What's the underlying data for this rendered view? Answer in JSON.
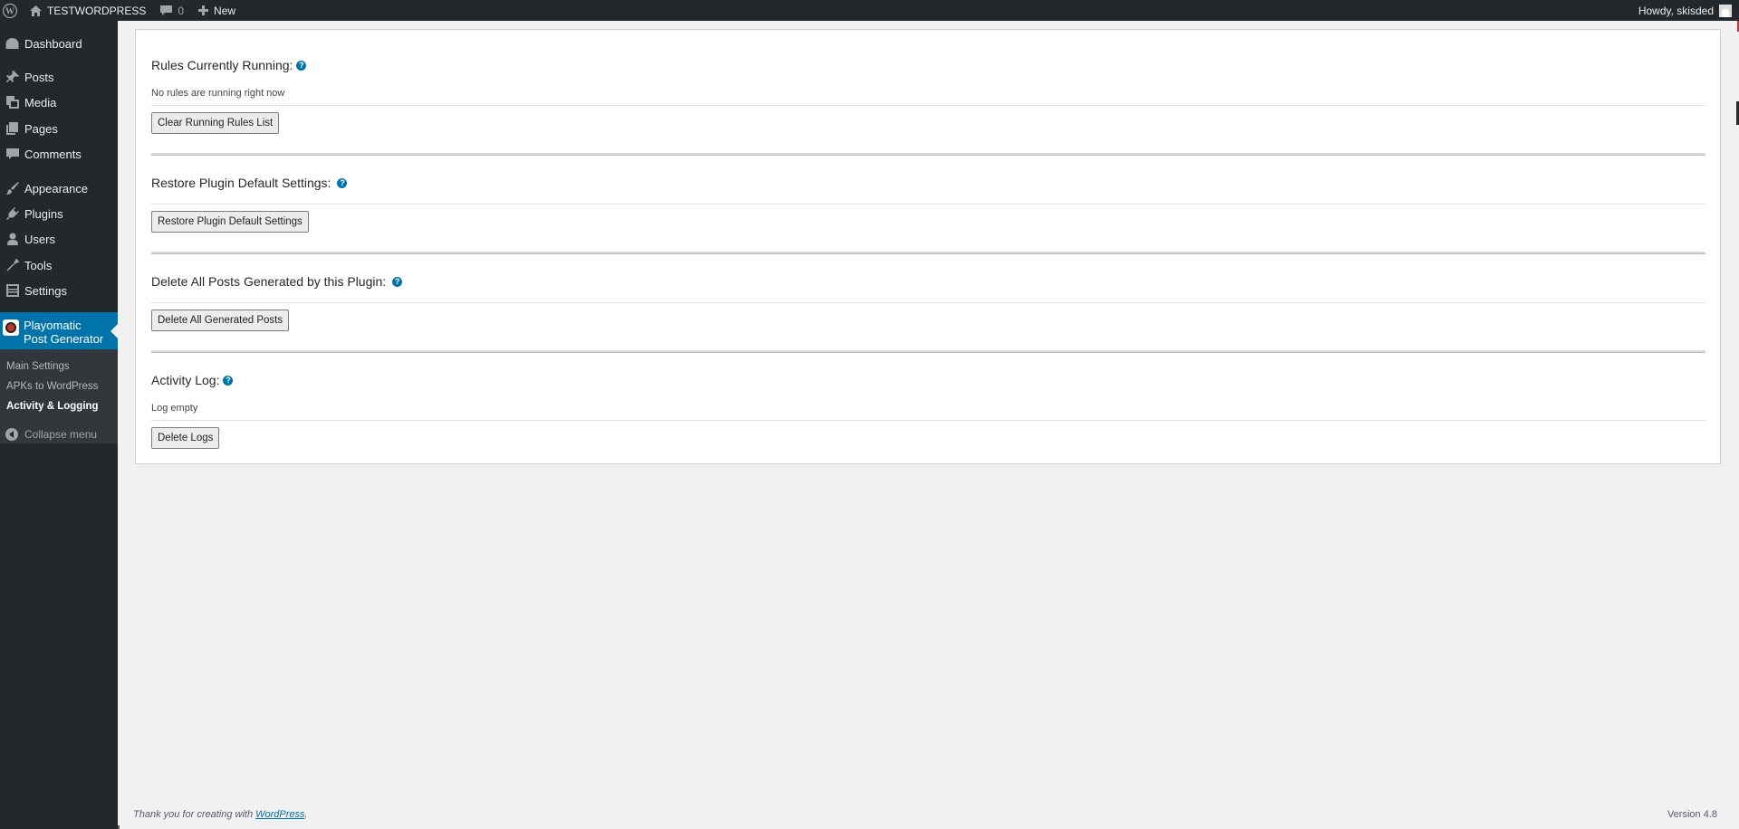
{
  "adminbar": {
    "site_name": "TESTWORDPRESS",
    "comments_count": "0",
    "new_label": "New",
    "howdy": "Howdy, skisded"
  },
  "sidebar": {
    "items": [
      {
        "label": "Dashboard",
        "icon": "dashboard-icon"
      },
      {
        "label": "Posts",
        "icon": "pin-icon"
      },
      {
        "label": "Media",
        "icon": "media-icon"
      },
      {
        "label": "Pages",
        "icon": "pages-icon"
      },
      {
        "label": "Comments",
        "icon": "comment-icon"
      },
      {
        "label": "Appearance",
        "icon": "brush-icon"
      },
      {
        "label": "Plugins",
        "icon": "plug-icon"
      },
      {
        "label": "Users",
        "icon": "user-icon"
      },
      {
        "label": "Tools",
        "icon": "wrench-icon"
      },
      {
        "label": "Settings",
        "icon": "settings-icon"
      }
    ],
    "current": {
      "label": "Playomatic Post Generator"
    },
    "submenu": [
      {
        "label": "Main Settings"
      },
      {
        "label": "APKs to WordPress"
      },
      {
        "label": "Activity & Logging"
      }
    ],
    "collapse": "Collapse menu"
  },
  "sections": {
    "running": {
      "title": "Rules Currently Running:",
      "text": "No rules are running right now",
      "button": "Clear Running Rules List"
    },
    "restore": {
      "title": "Restore Plugin Default Settings:",
      "button": "Restore Plugin Default Settings"
    },
    "delete_posts": {
      "title": "Delete All Posts Generated by this Plugin:",
      "button": "Delete All Generated Posts"
    },
    "activity": {
      "title": "Activity Log:",
      "text": "Log empty",
      "button": "Delete Logs"
    }
  },
  "help_glyph": "?",
  "footer": {
    "thanks_prefix": "Thank you for creating with ",
    "thanks_link": "WordPress",
    "thanks_suffix": ".",
    "version": "Version 4.8"
  },
  "colors": {
    "admin_bar": "#23282d",
    "accent": "#0073aa",
    "background": "#f1f1f1"
  }
}
